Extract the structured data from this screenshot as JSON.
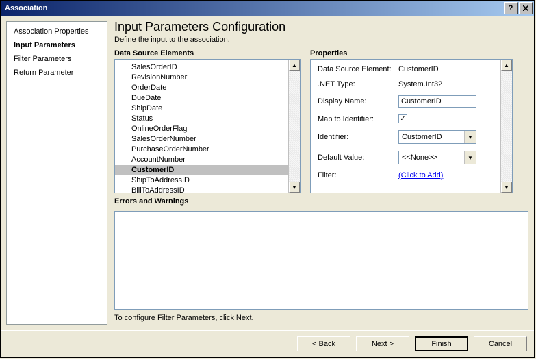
{
  "window": {
    "title": "Association"
  },
  "nav": {
    "items": [
      {
        "label": "Association Properties"
      },
      {
        "label": "Input Parameters"
      },
      {
        "label": "Filter Parameters"
      },
      {
        "label": "Return Parameter"
      }
    ]
  },
  "page": {
    "title": "Input Parameters Configuration",
    "subtitle": "Define the input to the association."
  },
  "dse": {
    "heading": "Data Source Elements",
    "items": [
      "SalesOrderID",
      "RevisionNumber",
      "OrderDate",
      "DueDate",
      "ShipDate",
      "Status",
      "OnlineOrderFlag",
      "SalesOrderNumber",
      "PurchaseOrderNumber",
      "AccountNumber",
      "CustomerID",
      "ShipToAddressID",
      "BillToAddressID"
    ]
  },
  "props": {
    "heading": "Properties",
    "dse_label": "Data Source Element:",
    "dse_value": "CustomerID",
    "nettype_label": ".NET Type:",
    "nettype_value": "System.Int32",
    "display_label": "Display Name:",
    "display_value": "CustomerID",
    "map_label": "Map to Identifier:",
    "id_label": "Identifier:",
    "id_value": "CustomerID",
    "default_label": "Default Value:",
    "default_value": "<<None>>",
    "filter_label": "Filter:",
    "filter_link": "(Click to Add)"
  },
  "errors": {
    "heading": "Errors and Warnings"
  },
  "hint": "To configure Filter Parameters, click Next.",
  "buttons": {
    "back": "< Back",
    "next": "Next >",
    "finish": "Finish",
    "cancel": "Cancel"
  }
}
